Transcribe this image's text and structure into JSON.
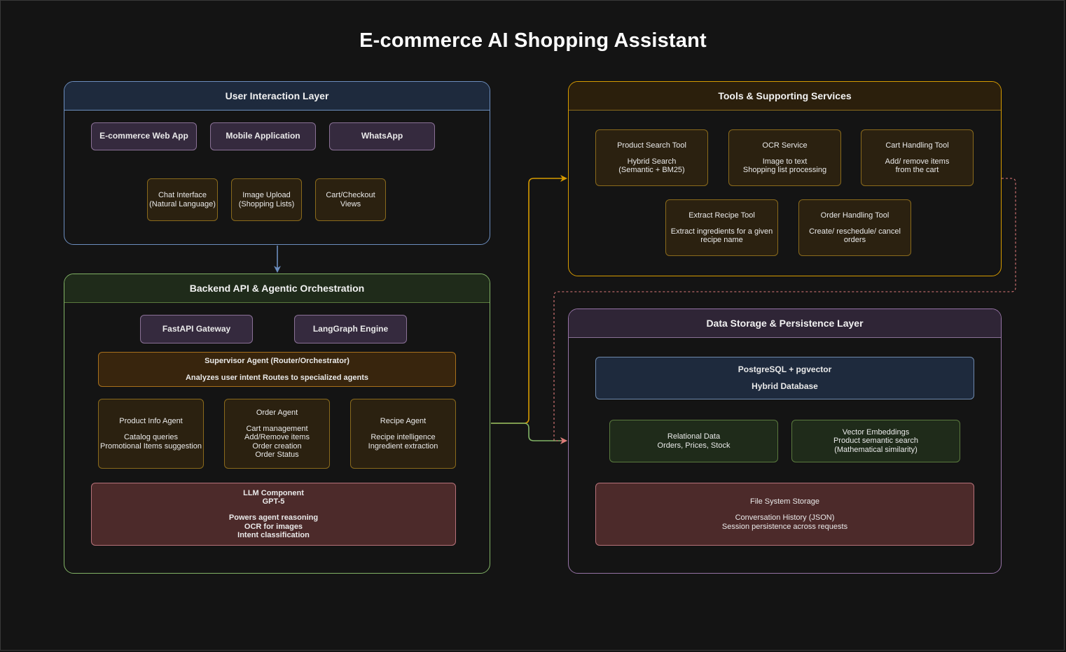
{
  "title": "E-commerce AI Shopping Assistant",
  "colors": {
    "background": "#141414",
    "user_layer": "#6c8ebf",
    "backend_layer": "#82b366",
    "tools_layer": "#d79b00",
    "storage_layer": "#9673a6",
    "edge_tools": "#d79b00",
    "edge_storage": "#82b366",
    "edge_dashed": "#b85450"
  },
  "user_layer": {
    "title": "User Interaction Layer",
    "channels": [
      "E-commerce Web App",
      "Mobile Application",
      "WhatsApp"
    ],
    "features": [
      {
        "line1": "Chat Interface",
        "line2": "(Natural Language)"
      },
      {
        "line1": "Image Upload",
        "line2": "(Shopping Lists)"
      },
      {
        "line1": "Cart/Checkout",
        "line2": "Views"
      }
    ]
  },
  "backend": {
    "title": "Backend API & Agentic Orchestration",
    "gateway": "FastAPI Gateway",
    "engine": "LangGraph Engine",
    "supervisor": {
      "name": "Supervisor Agent (Router/Orchestrator)",
      "desc": "Analyzes user intent Routes to specialized agents"
    },
    "agents": [
      {
        "name": "Product Info Agent",
        "lines": [
          "Catalog queries",
          "Promotional Items suggestion"
        ]
      },
      {
        "name": "Order Agent",
        "lines": [
          "Cart management",
          "Add/Remove items",
          "Order creation",
          "Order Status"
        ]
      },
      {
        "name": "Recipe Agent",
        "lines": [
          "Recipe intelligence",
          "Ingredient extraction"
        ]
      }
    ],
    "llm": {
      "name": "LLM Component",
      "model": "GPT-5",
      "lines": [
        "Powers agent reasoning",
        "OCR for images",
        "Intent classification"
      ]
    }
  },
  "tools": {
    "title": "Tools & Supporting Services",
    "items": [
      {
        "name": "Product Search Tool",
        "lines": [
          "Hybrid Search",
          "(Semantic + BM25)"
        ]
      },
      {
        "name": "OCR Service",
        "lines": [
          "Image to text",
          "Shopping list processing"
        ]
      },
      {
        "name": "Cart Handling Tool",
        "lines": [
          "Add/ remove items",
          "from the cart"
        ]
      },
      {
        "name": "Extract Recipe Tool",
        "lines": [
          "Extract ingredients for a given",
          "recipe name"
        ]
      },
      {
        "name": "Order Handling Tool",
        "lines": [
          "Create/ reschedule/ cancel",
          "orders"
        ]
      }
    ]
  },
  "storage": {
    "title": "Data Storage & Persistence Layer",
    "database": {
      "name": "PostgreSQL + pgvector",
      "desc": "Hybrid Database"
    },
    "relational": {
      "name": "Relational Data",
      "desc": "Orders, Prices, Stock"
    },
    "vector": {
      "name": "Vector Embeddings",
      "lines": [
        "Product semantic search",
        "(Mathematical similarity)"
      ]
    },
    "files": {
      "name": "File System Storage",
      "lines": [
        "Conversation History (JSON)",
        "Session persistence across requests"
      ]
    }
  }
}
